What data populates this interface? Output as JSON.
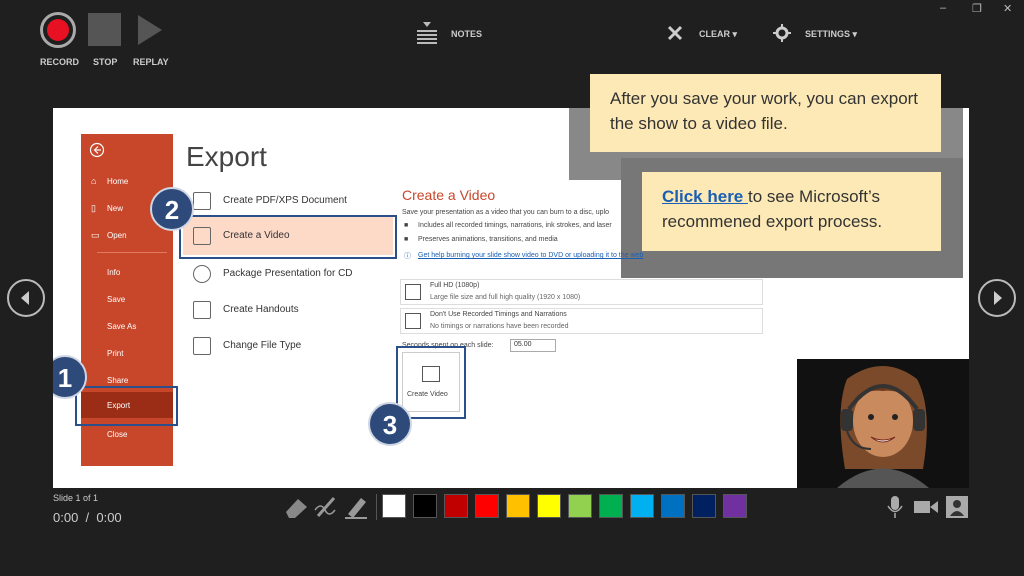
{
  "window": {
    "minimize": "–",
    "restore": "❐",
    "close": "✕"
  },
  "toolbar": {
    "record_label": "RECORD",
    "stop_label": "STOP",
    "replay_label": "REPLAY",
    "notes_label": "NOTES",
    "clear_label": "CLEAR ▾",
    "settings_label": "SETTINGS ▾"
  },
  "backstage": {
    "back_icon": "back-arrow-icon",
    "items": [
      "Home",
      "New",
      "Open",
      "Info",
      "Save",
      "Save As",
      "Print",
      "Share",
      "Export",
      "Close"
    ]
  },
  "export": {
    "title": "Export",
    "options": [
      "Create PDF/XPS Document",
      "Create a Video",
      "Package Presentation for CD",
      "Create Handouts",
      "Change File Type"
    ]
  },
  "create_video": {
    "heading": "Create a Video",
    "desc": "Save your presentation as a video that you can burn to a disc, uplo",
    "bullets": [
      "Includes all recorded timings, narrations, ink strokes, and laser",
      "Preserves animations, transitions, and media"
    ],
    "help_link": "Get help burning your slide show video to DVD or uploading it to the web",
    "quality_title": "Full HD (1080p)",
    "quality_desc": "Large file size and full high quality (1920 x 1080)",
    "timing_title": "Don't Use Recorded Timings and Narrations",
    "timing_desc": "No timings or narrations have been recorded",
    "seconds_label": "Seconds spent on each slide:",
    "seconds_value": "05.00",
    "create_button": "Create Video"
  },
  "badges": [
    "1",
    "2",
    "3"
  ],
  "callouts": {
    "top": "After you save your work, you can export the show to a video file.",
    "link_text": "Click here ",
    "bottom_rest": "to see Microsoft’s recommened export process."
  },
  "status": {
    "slide": "Slide 1 of 1",
    "time": "0:00  /  0:00"
  },
  "ink_tools": [
    "eraser-icon",
    "pen-icon",
    "highlighter-icon"
  ],
  "colors": [
    "#ffffff",
    "#000000",
    "#c00000",
    "#ff0000",
    "#ffc000",
    "#ffff00",
    "#92d050",
    "#00b050",
    "#00b0f0",
    "#0070c0",
    "#002060",
    "#7030a0"
  ],
  "accent": {
    "record": "#e81123",
    "highlight": "#fdd9c8",
    "badge": "#2e4a7a",
    "callout": "#fde9b5",
    "link": "#1a5fb4"
  },
  "media_controls": [
    "microphone-icon",
    "camera-icon",
    "camera-preview-icon"
  ]
}
